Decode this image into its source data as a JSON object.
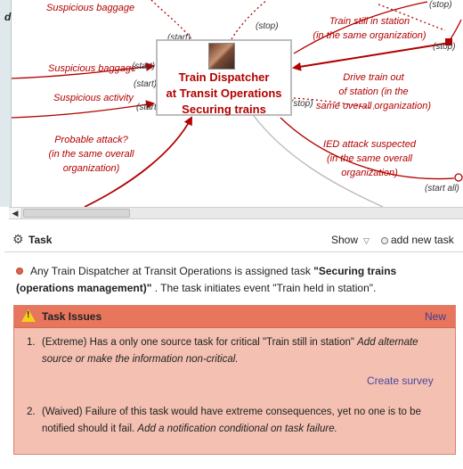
{
  "diagram": {
    "left_strip_text": "d",
    "node": {
      "title_line1": "Train Dispatcher",
      "title_line2": "at Transit Operations",
      "title_line3": "Securing trains"
    },
    "flow_labels": {
      "suspicious_baggage_top": "Suspicious baggage",
      "suspicious_baggage": "Suspicious baggage",
      "suspicious_activity": "Suspicious activity",
      "probable_attack_1": "Probable attack?",
      "probable_attack_2": "(in the same overall",
      "probable_attack_3": "organization)",
      "train_still_1": "Train still in station",
      "train_still_2": "(in the same organization)",
      "drive_out_1": "Drive train out",
      "drive_out_2": "of station (in the",
      "drive_out_3": "same overall organization)",
      "ied_1": "IED attack suspected",
      "ied_2": "(in the same overall",
      "ied_3": "organization)"
    },
    "tags": {
      "start_1": "(start)",
      "start_2": "(start)",
      "start_3": "(start)",
      "start_4": "(start)",
      "stop_1": "(stop)",
      "stop_2": "(stop)",
      "stop_3": "(stop)",
      "stop_4": "(stop)",
      "start_all": "(start all)"
    },
    "colors": {
      "flow": "#b30000",
      "node_border": "#bdbdbd"
    }
  },
  "task_panel": {
    "title": "Task",
    "show_label": "Show",
    "add_task_label": "add new task",
    "description": {
      "prefix": "Any Train Dispatcher at Transit Operations is assigned task ",
      "task_name": "\"Securing trains (operations management)\"",
      "suffix": " . The task initiates event \"Train held in station\"."
    },
    "issues": {
      "title": "Task Issues",
      "new_label": "New",
      "items": [
        {
          "number": "1.",
          "text": "(Extreme) Has a only one source task for critical \"Train still in station\" ",
          "remedy": "Add alternate source or make the information non-critical."
        },
        {
          "number": "2.",
          "text": "(Waived) Failure of this task would have extreme consequences, yet no one is to be notified should it fail. ",
          "remedy": "Add a notification conditional on task failure."
        }
      ],
      "create_survey_label": "Create survey"
    },
    "colors": {
      "issues_header": "#e8765d",
      "issues_body": "#f3c0b1",
      "link": "#4a4aa0"
    }
  }
}
